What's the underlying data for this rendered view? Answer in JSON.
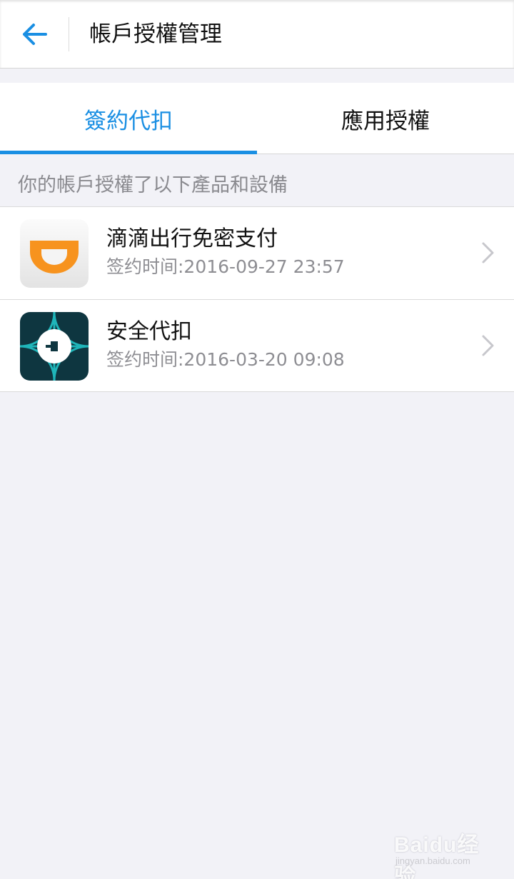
{
  "header": {
    "title": "帳戶授權管理",
    "back_icon": "arrow-left-icon"
  },
  "tabs": [
    {
      "label": "簽約代扣",
      "active": true
    },
    {
      "label": "應用授權",
      "active": false
    }
  ],
  "section": {
    "header": "你的帳戶授權了以下產品和設備"
  },
  "items": [
    {
      "title": "滴滴出行免密支付",
      "time": "签约时间:2016-09-27 23:57",
      "icon": "didi-logo-icon"
    },
    {
      "title": "安全代扣",
      "time": "签约时间:2016-03-20 09:08",
      "icon": "uber-logo-icon"
    }
  ],
  "colors": {
    "accent": "#1a8fe3",
    "background": "#f2f2f7",
    "didi_orange": "#f7931e",
    "uber_teal": "#1fb5b9"
  },
  "watermark": {
    "brand": "Baidu经验",
    "url": "jingyan.baidu.com"
  }
}
